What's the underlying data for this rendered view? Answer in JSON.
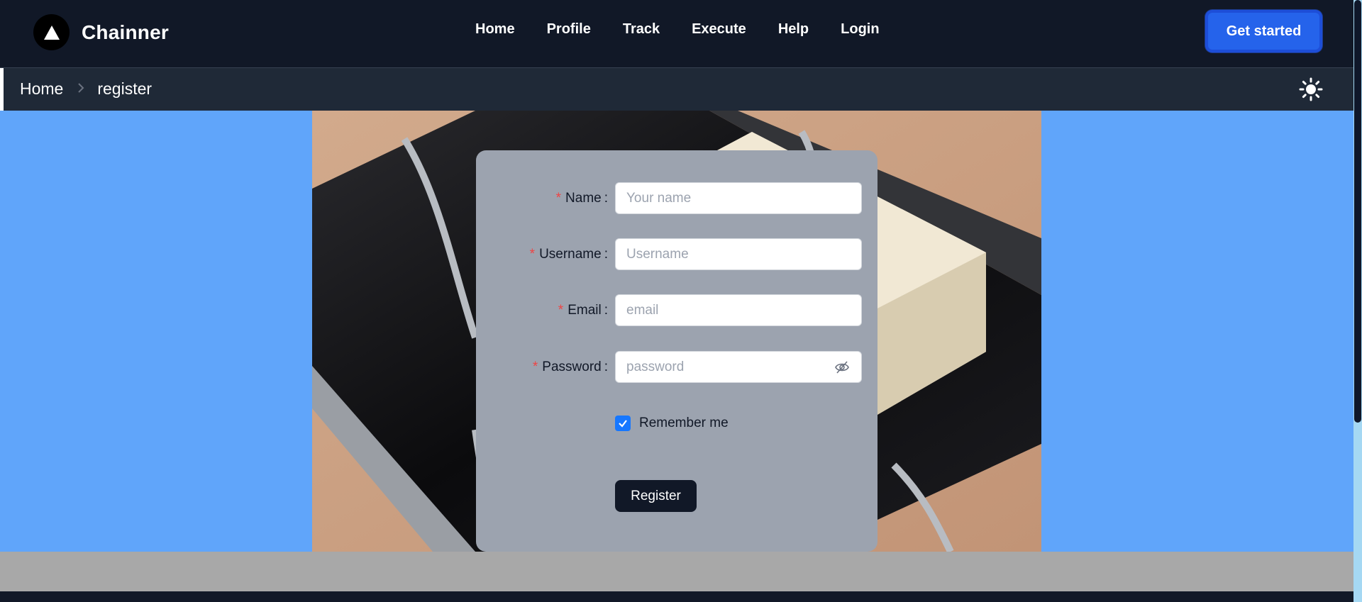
{
  "app": {
    "name": "Chainner"
  },
  "nav": {
    "items": [
      "Home",
      "Profile",
      "Track",
      "Execute",
      "Help",
      "Login"
    ]
  },
  "header": {
    "cta_label": "Get started"
  },
  "breadcrumb": {
    "items": [
      "Home",
      "register"
    ]
  },
  "form": {
    "required_mark": "*",
    "fields": [
      {
        "label": "Name",
        "placeholder": "Your name",
        "value": ""
      },
      {
        "label": "Username",
        "placeholder": "Username",
        "value": ""
      },
      {
        "label": "Email",
        "placeholder": "email",
        "value": ""
      },
      {
        "label": "Password",
        "placeholder": "password",
        "value": ""
      }
    ],
    "remember_label": "Remember me",
    "remember_checked": true,
    "submit_label": "Register"
  },
  "icons": {
    "logo": "triangle-logo-icon",
    "theme": "sun-icon",
    "breadcrumb_separator": "chevron-right-icon",
    "password_toggle": "eye-off-icon",
    "checkbox": "check-icon"
  },
  "colors": {
    "header_bg": "#111827",
    "breadcrumb_bg": "#1f2937",
    "page_bg": "#60a5fa",
    "card_bg": "#9ca3af",
    "accent": "#2563eb",
    "checkbox": "#1677ff",
    "required": "#ef4444"
  }
}
